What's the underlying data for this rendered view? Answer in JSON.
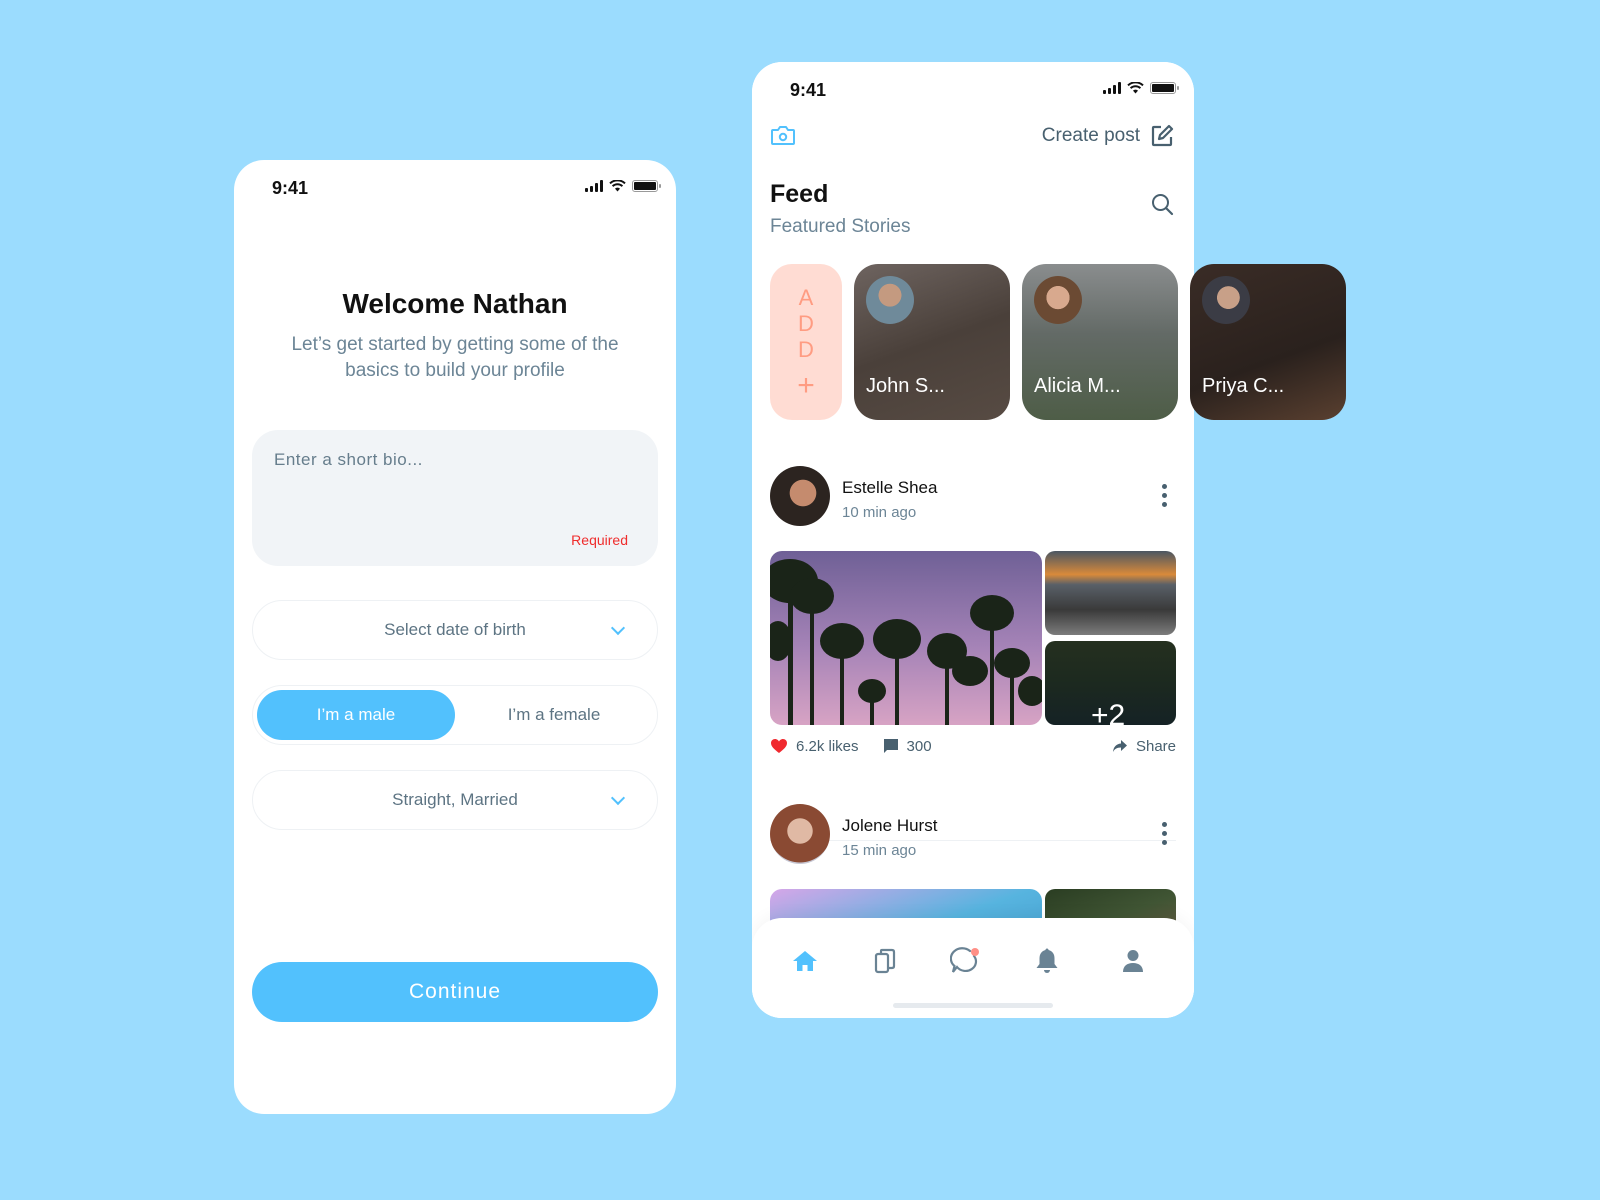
{
  "colors": {
    "background": "#9bdcfe",
    "accent": "#52c1fd",
    "required": "#ef2d2d",
    "story_add_bg": "#ffdcd3",
    "story_add_fg": "#ff9c82",
    "like_red": "#f0292f",
    "notification_dot": "#ff8f86"
  },
  "onboarding": {
    "status_time": "9:41",
    "title": "Welcome Nathan",
    "subtitle": "Let’s get started by getting some of the basics to build your profile",
    "bio": {
      "placeholder": "Enter a short bio...",
      "value": "",
      "required_label": "Required"
    },
    "dob_select": {
      "label": "Select date of birth"
    },
    "gender": {
      "options": [
        "I’m a male",
        "I’m a female"
      ],
      "selected": "I’m a male"
    },
    "relationship_select": {
      "label": "Straight, Married"
    },
    "continue_label": "Continue"
  },
  "feed": {
    "status_time": "9:41",
    "camera_icon": "camera-icon",
    "create_post_label": "Create post",
    "title": "Feed",
    "subtitle": "Featured Stories",
    "stories": {
      "add_letters": [
        "A",
        "D",
        "D"
      ],
      "add_plus": "+",
      "items": [
        {
          "name": "John S..."
        },
        {
          "name": "Alicia M..."
        },
        {
          "name": "Priya C..."
        }
      ]
    },
    "posts": [
      {
        "author": "Estelle Shea",
        "time": "10 min ago",
        "extra_images": "+2",
        "likes": "6.2k likes",
        "comments": "300",
        "share_label": "Share"
      },
      {
        "author": "Jolene Hurst",
        "time": "15 min ago"
      }
    ],
    "tabbar": {
      "items": [
        "home",
        "cards",
        "messages",
        "notifications",
        "profile"
      ],
      "active": "home",
      "messages_badge": true
    }
  }
}
